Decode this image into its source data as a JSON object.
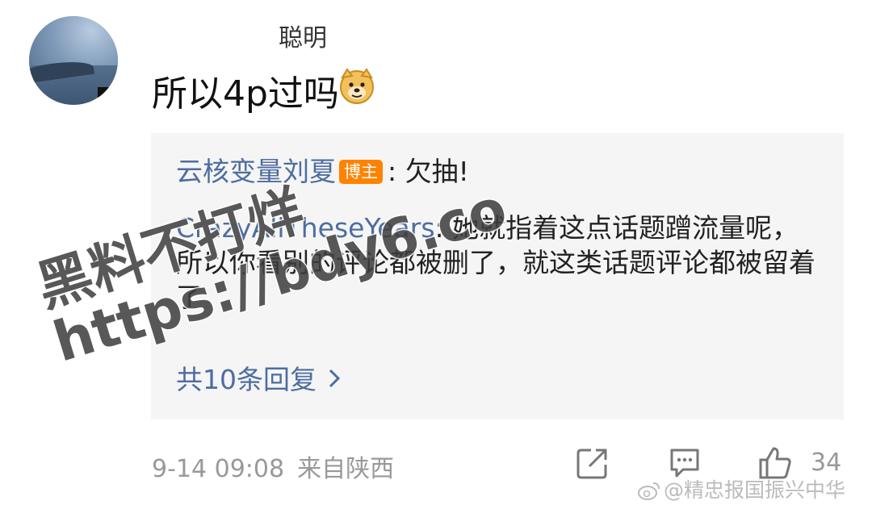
{
  "comment": {
    "username_partial": "聪明",
    "text": "所以4p过吗",
    "emoji": "doge-icon"
  },
  "replies": [
    {
      "author": "云核变量刘夏",
      "badge": "博主",
      "text": ": 欠抽!"
    },
    {
      "author": "CrazyAllTheseYears",
      "text": ": 她就指着这点话题蹭流量呢，所以你看别的评论都被删了，就这类话题评论都被留着了"
    }
  ],
  "view_more": "共10条回复",
  "meta": {
    "date": "9-14 09:08",
    "location": "来自陕西"
  },
  "actions": {
    "like_count": "34"
  },
  "watermarks": {
    "overlay_line1": "黑料不打烊",
    "overlay_line2": "https://bdy6.co",
    "corner": "@精忠报国振兴中华"
  },
  "colors": {
    "link_blue": "#4d6da0",
    "badge_orange": "#ff8200",
    "reply_bg": "#f5f5f5",
    "meta_gray": "#999999"
  }
}
